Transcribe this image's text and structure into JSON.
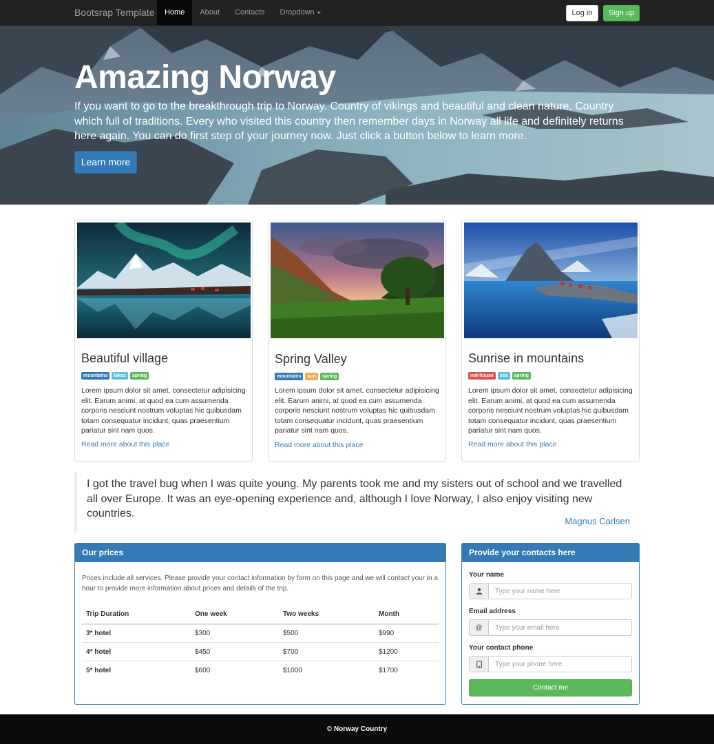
{
  "navbar": {
    "brand": "Bootsrap Template",
    "items": [
      {
        "label": "Home",
        "active": true
      },
      {
        "label": "About"
      },
      {
        "label": "Contacts"
      },
      {
        "label": "Dropdown"
      }
    ],
    "login_label": "Log in",
    "signup_label": "Sign up"
  },
  "hero": {
    "title": "Amazing Norway",
    "text": "If you want to go to the breakthrough trip to Norway. Country of vikings and beautiful and clean nature. Country which full of traditions. Every who visited this country then remember days in Norway all life and definitely returns here again. You can do first step of your journey now. Just click a button below to learn more.",
    "button_label": "Learn more"
  },
  "cards": [
    {
      "title": "Beautiful village",
      "tags": [
        {
          "label": "mountains",
          "color": "#337ab7"
        },
        {
          "label": "lakes",
          "color": "#5bc0de"
        },
        {
          "label": "spring",
          "color": "#5cb85c"
        }
      ],
      "text": "Lorem ipsum dolor sit amet, consectetur adipisicing elit. Earum animi, at quod ea cum assumenda corporis nesciunt nostrum voluptas hic quibusdam totam consequatur incidunt, quas praesentium pariatur sint nam quos.",
      "link": "Read more about this place"
    },
    {
      "title": "Spring Valley",
      "tags": [
        {
          "label": "mountains",
          "color": "#337ab7"
        },
        {
          "label": "sun",
          "color": "#f0ad4e"
        },
        {
          "label": "spring",
          "color": "#5cb85c"
        }
      ],
      "text": "Lorem ipsum dolor sit amet, consectetur adipisicing elit. Earum animi, at quod ea cum assumenda corporis nesciunt nostrum voluptas hic quibusdam totam consequatur incidunt, quas praesentium pariatur sint nam quos.",
      "link": "Read more about this place"
    },
    {
      "title": "Sunrise in mountains",
      "tags": [
        {
          "label": "red-house",
          "color": "#d9534f"
        },
        {
          "label": "sea",
          "color": "#5bc0de"
        },
        {
          "label": "spring",
          "color": "#5cb85c"
        }
      ],
      "text": "Lorem ipsum dolor sit amet, consectetur adipisicing elit. Earum animi, at quod ea cum assumenda corporis nesciunt nostrum voluptas hic quibusdam totam consequatur incidunt, quas praesentium pariatur sint nam quos.",
      "link": "Read more about this place"
    }
  ],
  "quote": {
    "text": "I got the travel bug when I was quite young. My parents took me and my sisters out of school and we travelled all over Europe. It was an eye-opening experience and, although I love Norway, I also enjoy visiting new countries.",
    "author": "Magnus Carlsen"
  },
  "prices": {
    "title": "Our prices",
    "intro": "Prices include all services. Please provide your contact information by form on this page and we will contact your in a hour to provide more information about prices and details of the trip.",
    "headers": [
      "Trip Duration",
      "One week",
      "Two weeks",
      "Month"
    ],
    "rows": [
      [
        "3* hotel",
        "$300",
        "$500",
        "$990"
      ],
      [
        "4* hotel",
        "$450",
        "$700",
        "$1200"
      ],
      [
        "5* hotel",
        "$600",
        "$1000",
        "$1700"
      ]
    ]
  },
  "contact": {
    "title": "Provide your contacts here",
    "name_label": "Your name",
    "name_placeholder": "Type your name here",
    "email_label": "Email address",
    "email_placeholder": "Type your email here",
    "phone_label": "Your contact phone",
    "phone_placeholder": "Type your phone here",
    "button_label": "Contact me"
  },
  "footer": {
    "text": "© Norway Country"
  }
}
